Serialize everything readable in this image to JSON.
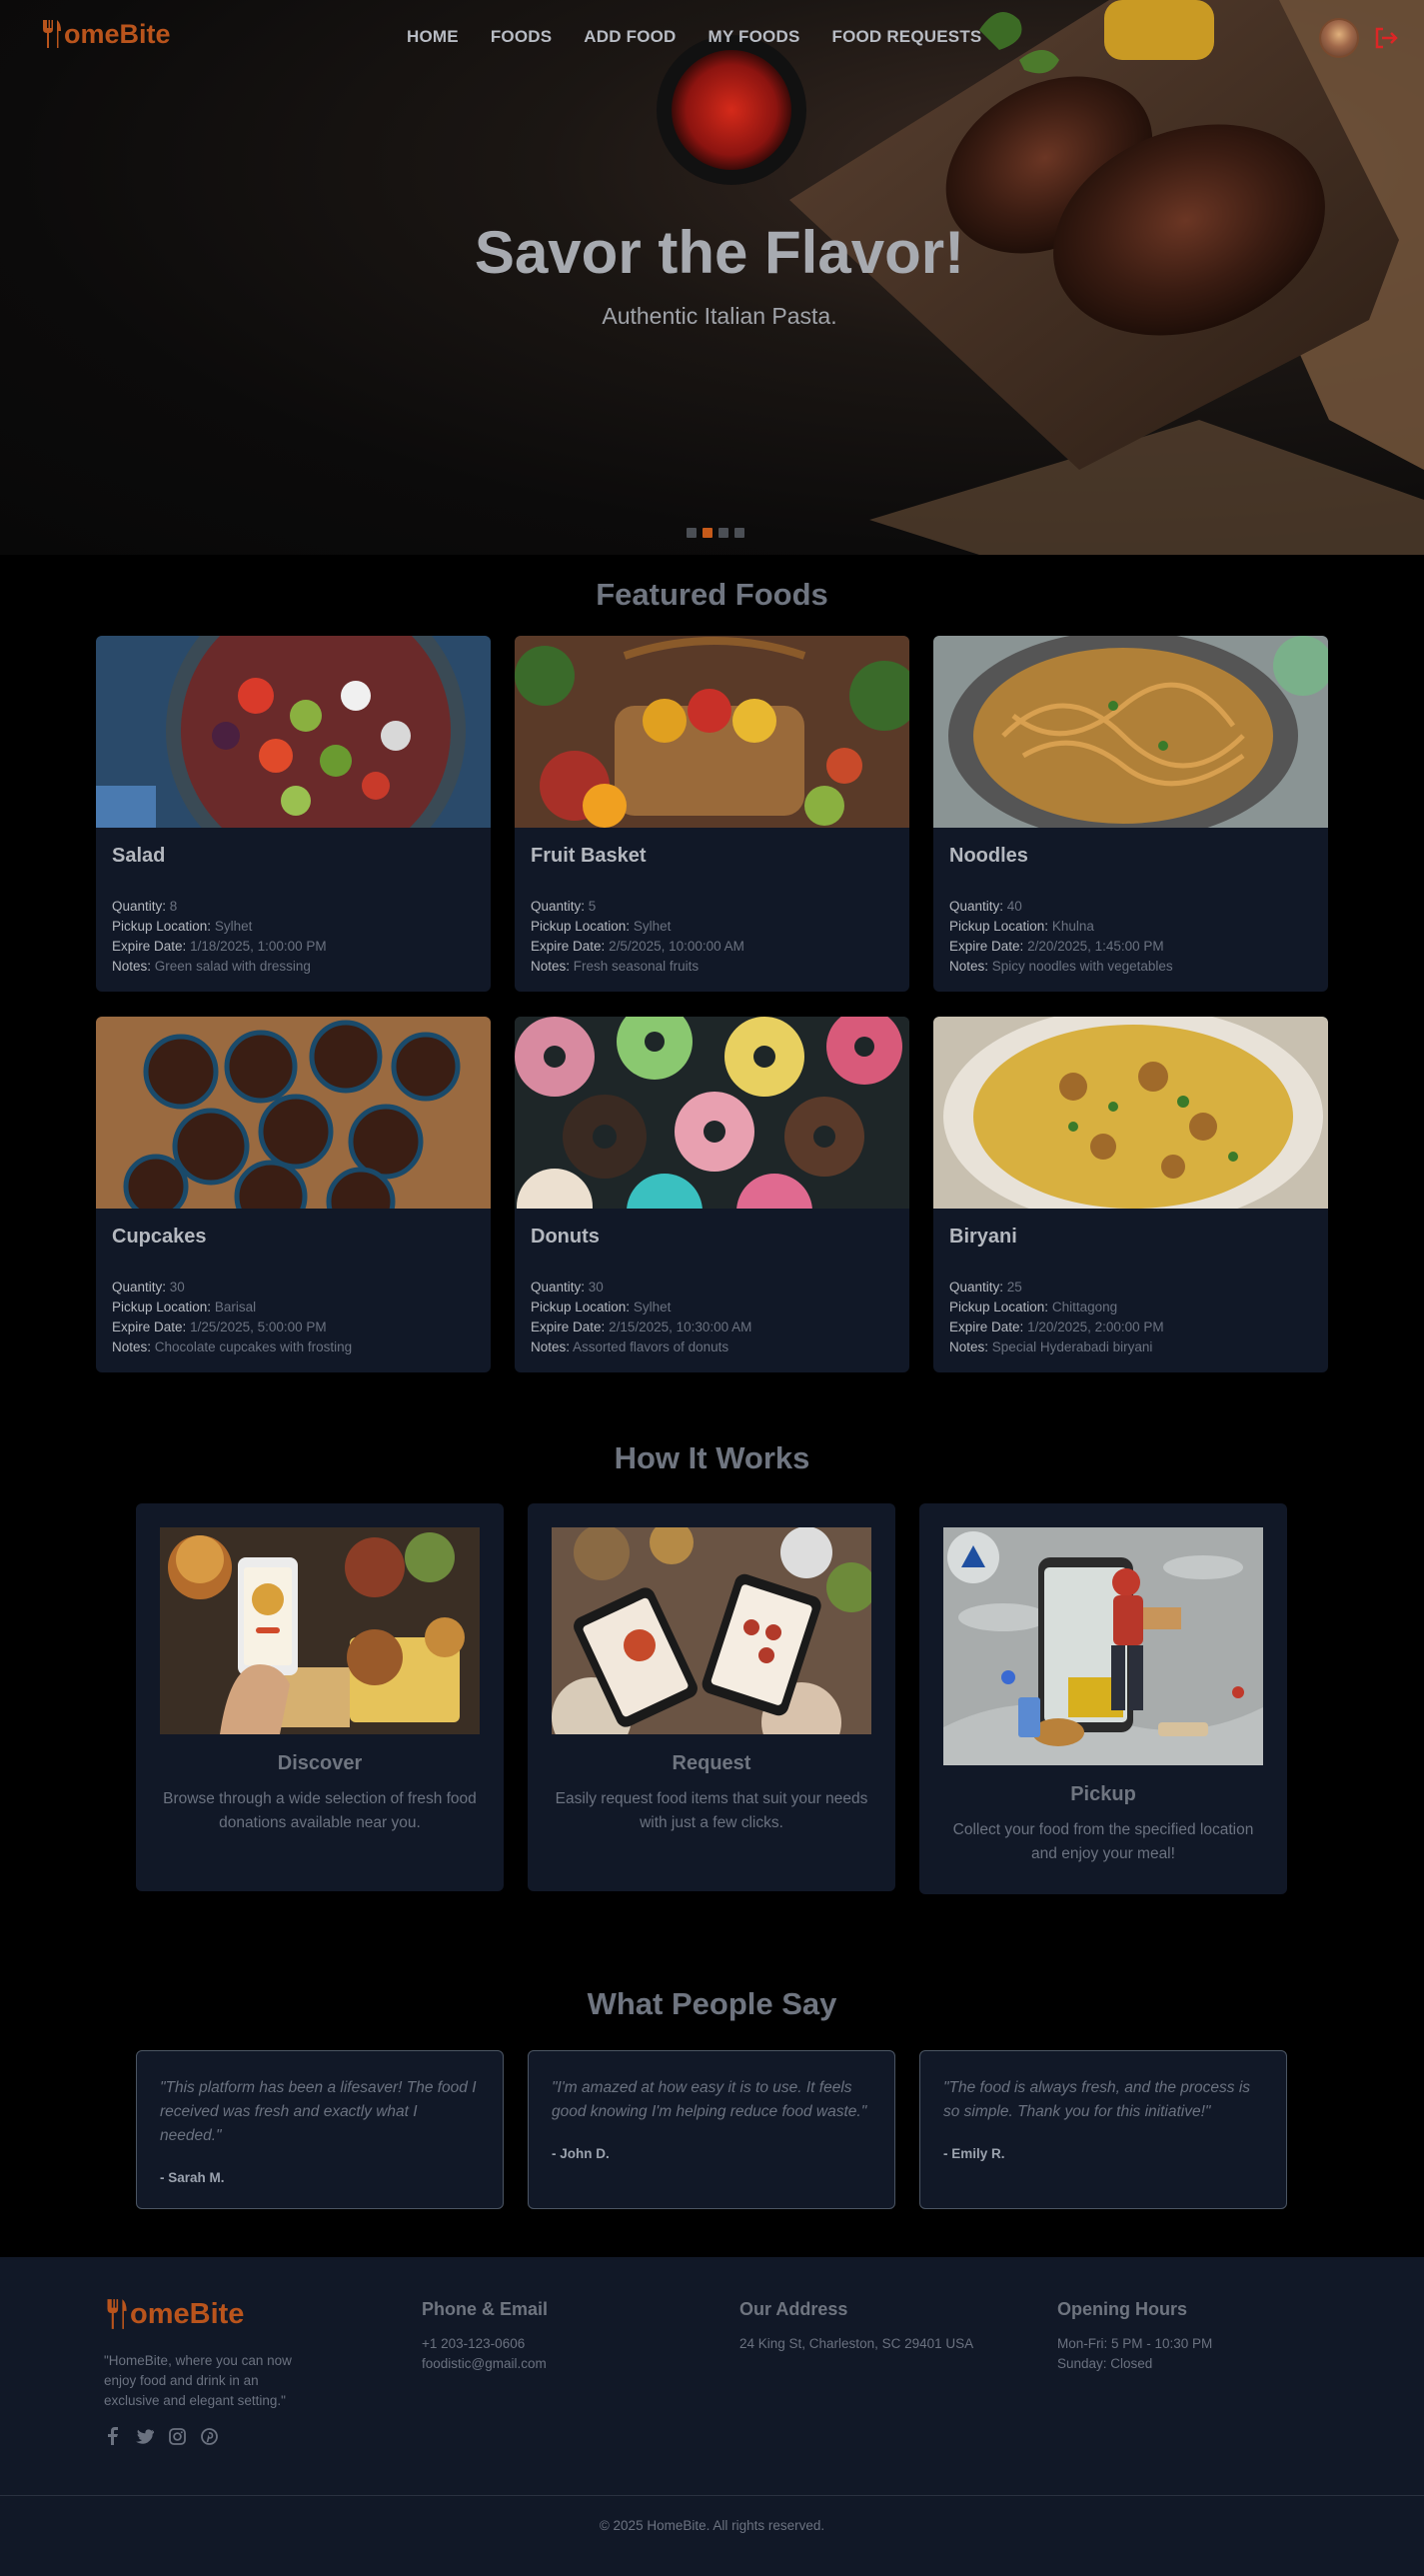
{
  "brand": {
    "name": "HomeBite",
    "logo_rest": "omeBite"
  },
  "nav": {
    "links": [
      "HOME",
      "FOODS",
      "ADD FOOD",
      "MY FOODS",
      "FOOD REQUESTS"
    ]
  },
  "hero": {
    "title": "Savor the Flavor!",
    "subtitle": "Authentic Italian Pasta.",
    "slides": 4,
    "active_slide": 1
  },
  "featured": {
    "title": "Featured Foods",
    "labels": {
      "quantity": "Quantity:",
      "location": "Pickup Location:",
      "expire": "Expire Date:",
      "notes": "Notes:"
    },
    "foods": [
      {
        "name": "Salad",
        "quantity": "8",
        "location": "Sylhet",
        "expire": "1/18/2025, 1:00:00 PM",
        "notes": "Green salad with dressing"
      },
      {
        "name": "Fruit Basket",
        "quantity": "5",
        "location": "Sylhet",
        "expire": "2/5/2025, 10:00:00 AM",
        "notes": "Fresh seasonal fruits"
      },
      {
        "name": "Noodles",
        "quantity": "40",
        "location": "Khulna",
        "expire": "2/20/2025, 1:45:00 PM",
        "notes": "Spicy noodles with vegetables"
      },
      {
        "name": "Cupcakes",
        "quantity": "30",
        "location": "Barisal",
        "expire": "1/25/2025, 5:00:00 PM",
        "notes": "Chocolate cupcakes with frosting"
      },
      {
        "name": "Donuts",
        "quantity": "30",
        "location": "Sylhet",
        "expire": "2/15/2025, 10:30:00 AM",
        "notes": "Assorted flavors of donuts"
      },
      {
        "name": "Biryani",
        "quantity": "25",
        "location": "Chittagong",
        "expire": "1/20/2025, 2:00:00 PM",
        "notes": "Special Hyderabadi biryani"
      }
    ]
  },
  "how": {
    "title": "How It Works",
    "steps": [
      {
        "name": "Discover",
        "desc": "Browse through a wide selection of fresh food donations available near you."
      },
      {
        "name": "Request",
        "desc": "Easily request food items that suit your needs with just a few clicks."
      },
      {
        "name": "Pickup",
        "desc": "Collect your food from the specified location and enjoy your meal!"
      }
    ]
  },
  "testimonials": {
    "title": "What People Say",
    "items": [
      {
        "quote": "\"This platform has been a lifesaver! The food I received was fresh and exactly what I needed.\"",
        "author": "- Sarah M."
      },
      {
        "quote": "\"I'm amazed at how easy it is to use. It feels good knowing I'm helping reduce food waste.\"",
        "author": "- John D."
      },
      {
        "quote": "\"The food is always fresh, and the process is so simple. Thank you for this initiative!\"",
        "author": "- Emily R."
      }
    ]
  },
  "footer": {
    "tagline": "\"HomeBite, where you can now enjoy food and drink in an exclusive and elegant setting.\"",
    "contact": {
      "title": "Phone & Email",
      "phone": "+1 203-123-0606",
      "email": "foodistic@gmail.com"
    },
    "address": {
      "title": "Our Address",
      "text": "24 King St, Charleston, SC 29401 USA"
    },
    "hours": {
      "title": "Opening Hours",
      "weekday": "Mon-Fri: 5 PM - 10:30 PM",
      "sunday": "Sunday: Closed"
    },
    "copyright": "© 2025 HomeBite. All rights reserved."
  },
  "colors": {
    "brand": "#b9541c",
    "card_bg": "#111827",
    "logout": "#dc2626"
  },
  "icons": [
    "fork-knife-icon",
    "logout-icon",
    "facebook-icon",
    "twitter-icon",
    "instagram-icon",
    "pinterest-icon"
  ]
}
